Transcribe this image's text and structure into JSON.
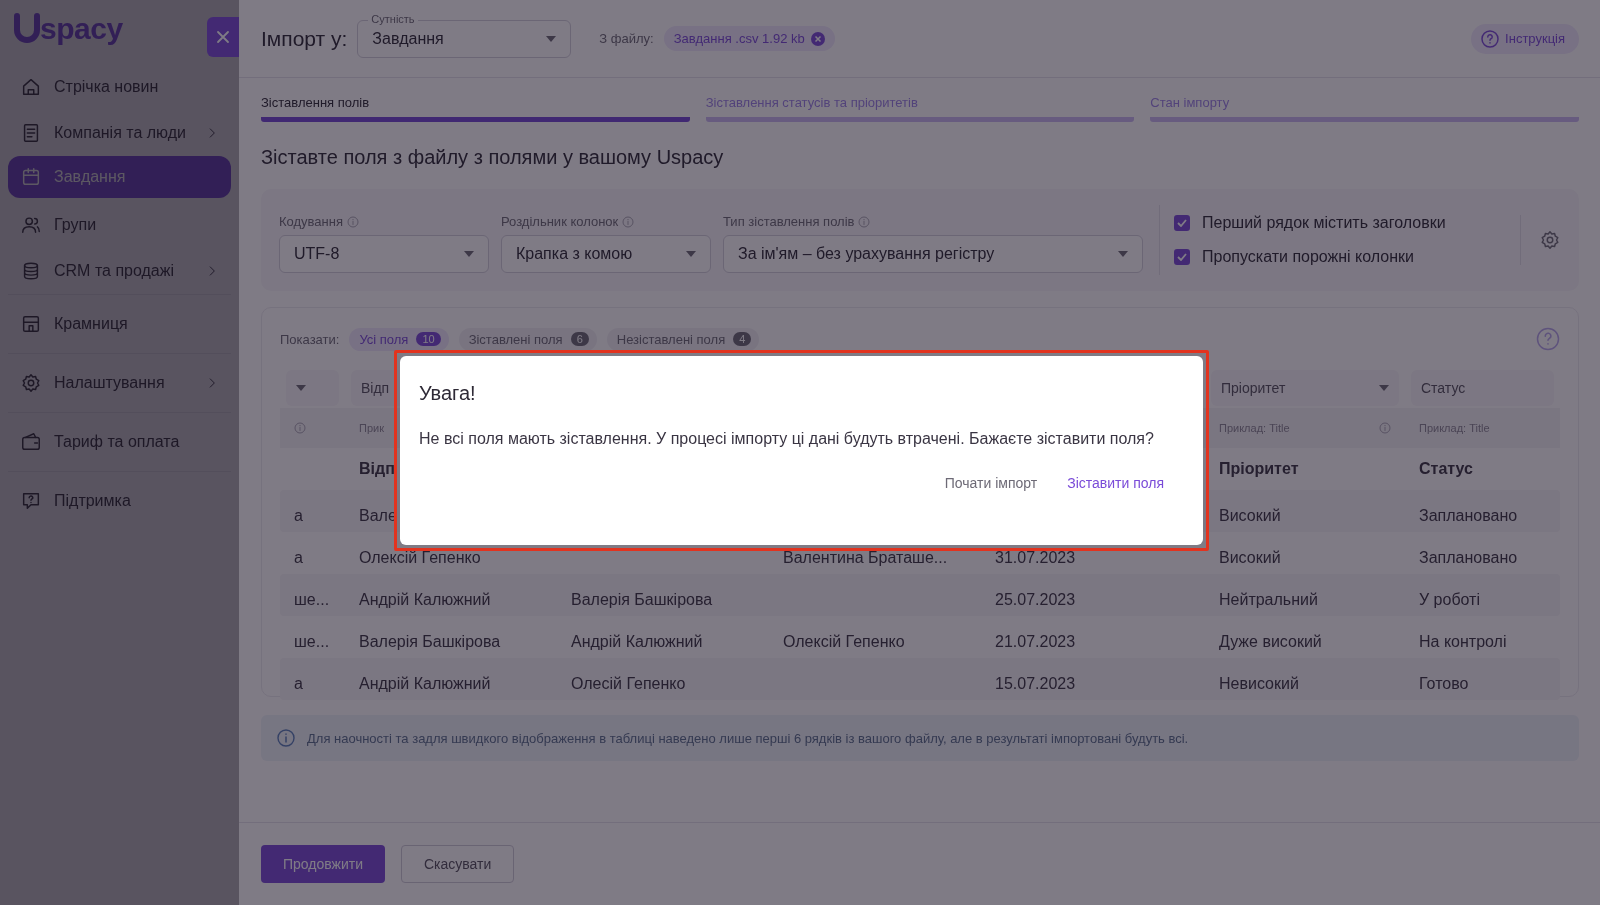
{
  "sidebar": {
    "logo": {
      "text": "spacy"
    },
    "items": [
      {
        "label": "Стрічка новин",
        "selected": false,
        "has_submenu": false
      },
      {
        "label": "Компанія та люди",
        "selected": false,
        "has_submenu": true
      },
      {
        "label": "Завдання",
        "selected": true,
        "has_submenu": false
      },
      {
        "label": "Групи",
        "selected": false,
        "has_submenu": false
      },
      {
        "label": "CRM та продажі",
        "selected": false,
        "has_submenu": true
      },
      {
        "label": "Крамниця",
        "selected": false,
        "has_submenu": false
      },
      {
        "label": "Налаштування",
        "selected": false,
        "has_submenu": true
      },
      {
        "label": "Тариф та оплата",
        "selected": false,
        "has_submenu": false
      },
      {
        "label": "Підтримка",
        "selected": false,
        "has_submenu": false
      }
    ]
  },
  "header": {
    "title": "Імпорт у:",
    "entity": {
      "label": "Сутність",
      "value": "Завдання"
    },
    "file_label": "З файлу:",
    "file_chip": "Завдання .csv 1.92 kb",
    "help_button": "Інструкція"
  },
  "steps": [
    {
      "label": "Зіставлення полів",
      "selected": true
    },
    {
      "label": "Зіставлення статусів та пріоритетів",
      "selected": false
    },
    {
      "label": "Стан імпорту",
      "selected": false
    }
  ],
  "heading": "Зіставте поля з файлу з полями у вашому Uspacy",
  "settings": {
    "selects": [
      {
        "label": "Кодування",
        "value": "UTF-8"
      },
      {
        "label": "Роздільник колонок",
        "value": "Крапка з комою"
      },
      {
        "label": "Тип зіставлення полів",
        "value": "За ім'ям – без урахування регістру"
      }
    ],
    "checkboxes": [
      {
        "label": "Перший рядок містить заголовки",
        "checked": true
      },
      {
        "label": "Пропускати порожні колонки",
        "checked": true
      }
    ]
  },
  "filter": {
    "label": "Показати:",
    "chips": [
      {
        "label": "Усі поля",
        "count": "10",
        "selected": true
      },
      {
        "label": "Зіставлені поля",
        "count": "6",
        "selected": false
      },
      {
        "label": "Незіставлені поля",
        "count": "4",
        "selected": false
      }
    ]
  },
  "table": {
    "columns": [
      {},
      {
        "field_select": "Відп",
        "example": "Прик",
        "header": "Відп"
      },
      {},
      {},
      {},
      {
        "field_select": "Пріоритет",
        "example": "Приклад: Title",
        "header": "Пріоритет"
      },
      {
        "field_select": "Статус",
        "example": "Приклад: Title",
        "header": "Статус"
      }
    ],
    "rows": [
      {
        "cells": [
          "а",
          "Вале",
          null,
          null,
          null,
          "Високий",
          "Заплановано"
        ]
      },
      {
        "cells": [
          "а",
          "Олексій Гепенко",
          null,
          "Валентина Браташе...",
          "31.07.2023",
          "Високий",
          "Заплановано"
        ]
      },
      {
        "cells": [
          "ше...",
          "Андрій Калюжний",
          "Валерія Башкірова",
          null,
          "25.07.2023",
          "Нейтральний",
          "У роботі"
        ]
      },
      {
        "cells": [
          "ше...",
          "Валерія Башкірова",
          "Андрій Калюжний",
          "Олексій Гепенко",
          "21.07.2023",
          "Дуже високий",
          "На контролі"
        ]
      },
      {
        "cells": [
          "а",
          "Андрій Калюжний",
          "Олесій Гепенко",
          null,
          "15.07.2023",
          "Невисокий",
          "Готово"
        ]
      }
    ]
  },
  "info_banner": "Для наочності та задля швидкого відображення в таблиці наведено лише перші 6 рядків із вашого файлу, але в результаті імпортовані будуть всі.",
  "footer": {
    "primary": "Продовжити",
    "secondary": "Скасувати"
  },
  "dialog": {
    "title": "Увага!",
    "message": "Не всі поля мають зіставлення. У процесі імпорту ці дані будуть втрачені. Бажаєте зіставити поля?",
    "buttons": [
      {
        "label": "Почати імпорт",
        "kind": "secondary"
      },
      {
        "label": "Зіставити поля",
        "kind": "primary"
      }
    ]
  }
}
